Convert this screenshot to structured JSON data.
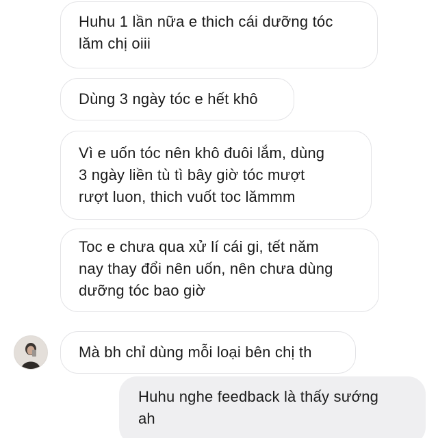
{
  "messages": [
    {
      "direction": "incoming",
      "text": "Huhu 1 lần nữa e thich cái dưỡng tóc\nlăm chị oiii"
    },
    {
      "direction": "incoming",
      "text": "Dùng 3 ngày tóc e hết khô"
    },
    {
      "direction": "incoming",
      "text": "Vì e uốn tóc nên khô đuôi lắm, dùng\n3 ngày liền tù tì bây giờ tóc mượt\nrượt luon, thich vuốt toc lămmm"
    },
    {
      "direction": "incoming",
      "text": "Toc e chưa qua xử lí cái gi, tết năm\nnay thay đổi nên uốn, nên chưa dùng\ndưỡng tóc bao giờ"
    },
    {
      "direction": "incoming",
      "text": "Mà bh chỉ dùng mỗi loại bên chị th"
    },
    {
      "direction": "outgoing",
      "text": "Huhu nghe feedback là thấy sướng\nah"
    }
  ],
  "colors": {
    "incoming_bubble": "#ffffff",
    "incoming_border": "#e3e3e6",
    "outgoing_bubble": "#efeff1",
    "text": "#1a1a1a"
  },
  "avatar": {
    "icon": "contact-avatar-icon"
  }
}
